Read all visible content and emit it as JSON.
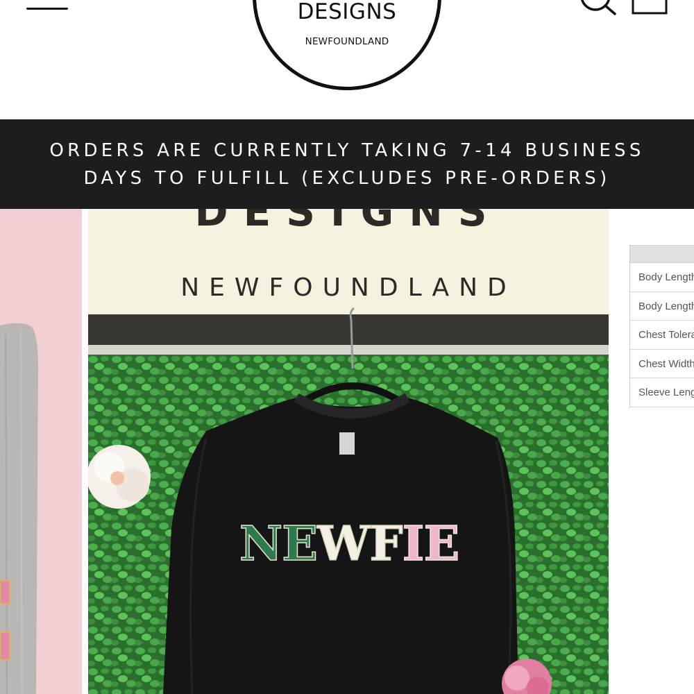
{
  "header": {
    "logo_main": "DESIGNS",
    "logo_sub": "NEWFOUNDLAND",
    "icons": [
      "menu-icon",
      "search-icon",
      "cart-icon"
    ]
  },
  "announcement": {
    "line1": "ORDERS ARE CURRENTLY TAKING 7-14 BUSINESS",
    "line2": "DAYS TO FULFILL (EXCLUDES PRE-ORDERS)"
  },
  "photo": {
    "sign_top": "DESIGNS",
    "sign_sub": "NEWFOUNDLAND",
    "shirt_letters": [
      {
        "ch": "N",
        "tone": "g"
      },
      {
        "ch": "E",
        "tone": "g"
      },
      {
        "ch": "W",
        "tone": "w"
      },
      {
        "ch": "F",
        "tone": "w"
      },
      {
        "ch": "I",
        "tone": "p"
      },
      {
        "ch": "E",
        "tone": "p"
      }
    ]
  },
  "size_table": {
    "rows": [
      "Body Length",
      "Body Length",
      "Chest Tolerance",
      "Chest Width",
      "Sleeve Length"
    ]
  },
  "colors": {
    "announcement_bg": "#1d1d1d",
    "side_slide_bg": "#f1cfd2",
    "hedge_green": "#2f7d35",
    "sweatshirt": "#151515"
  }
}
